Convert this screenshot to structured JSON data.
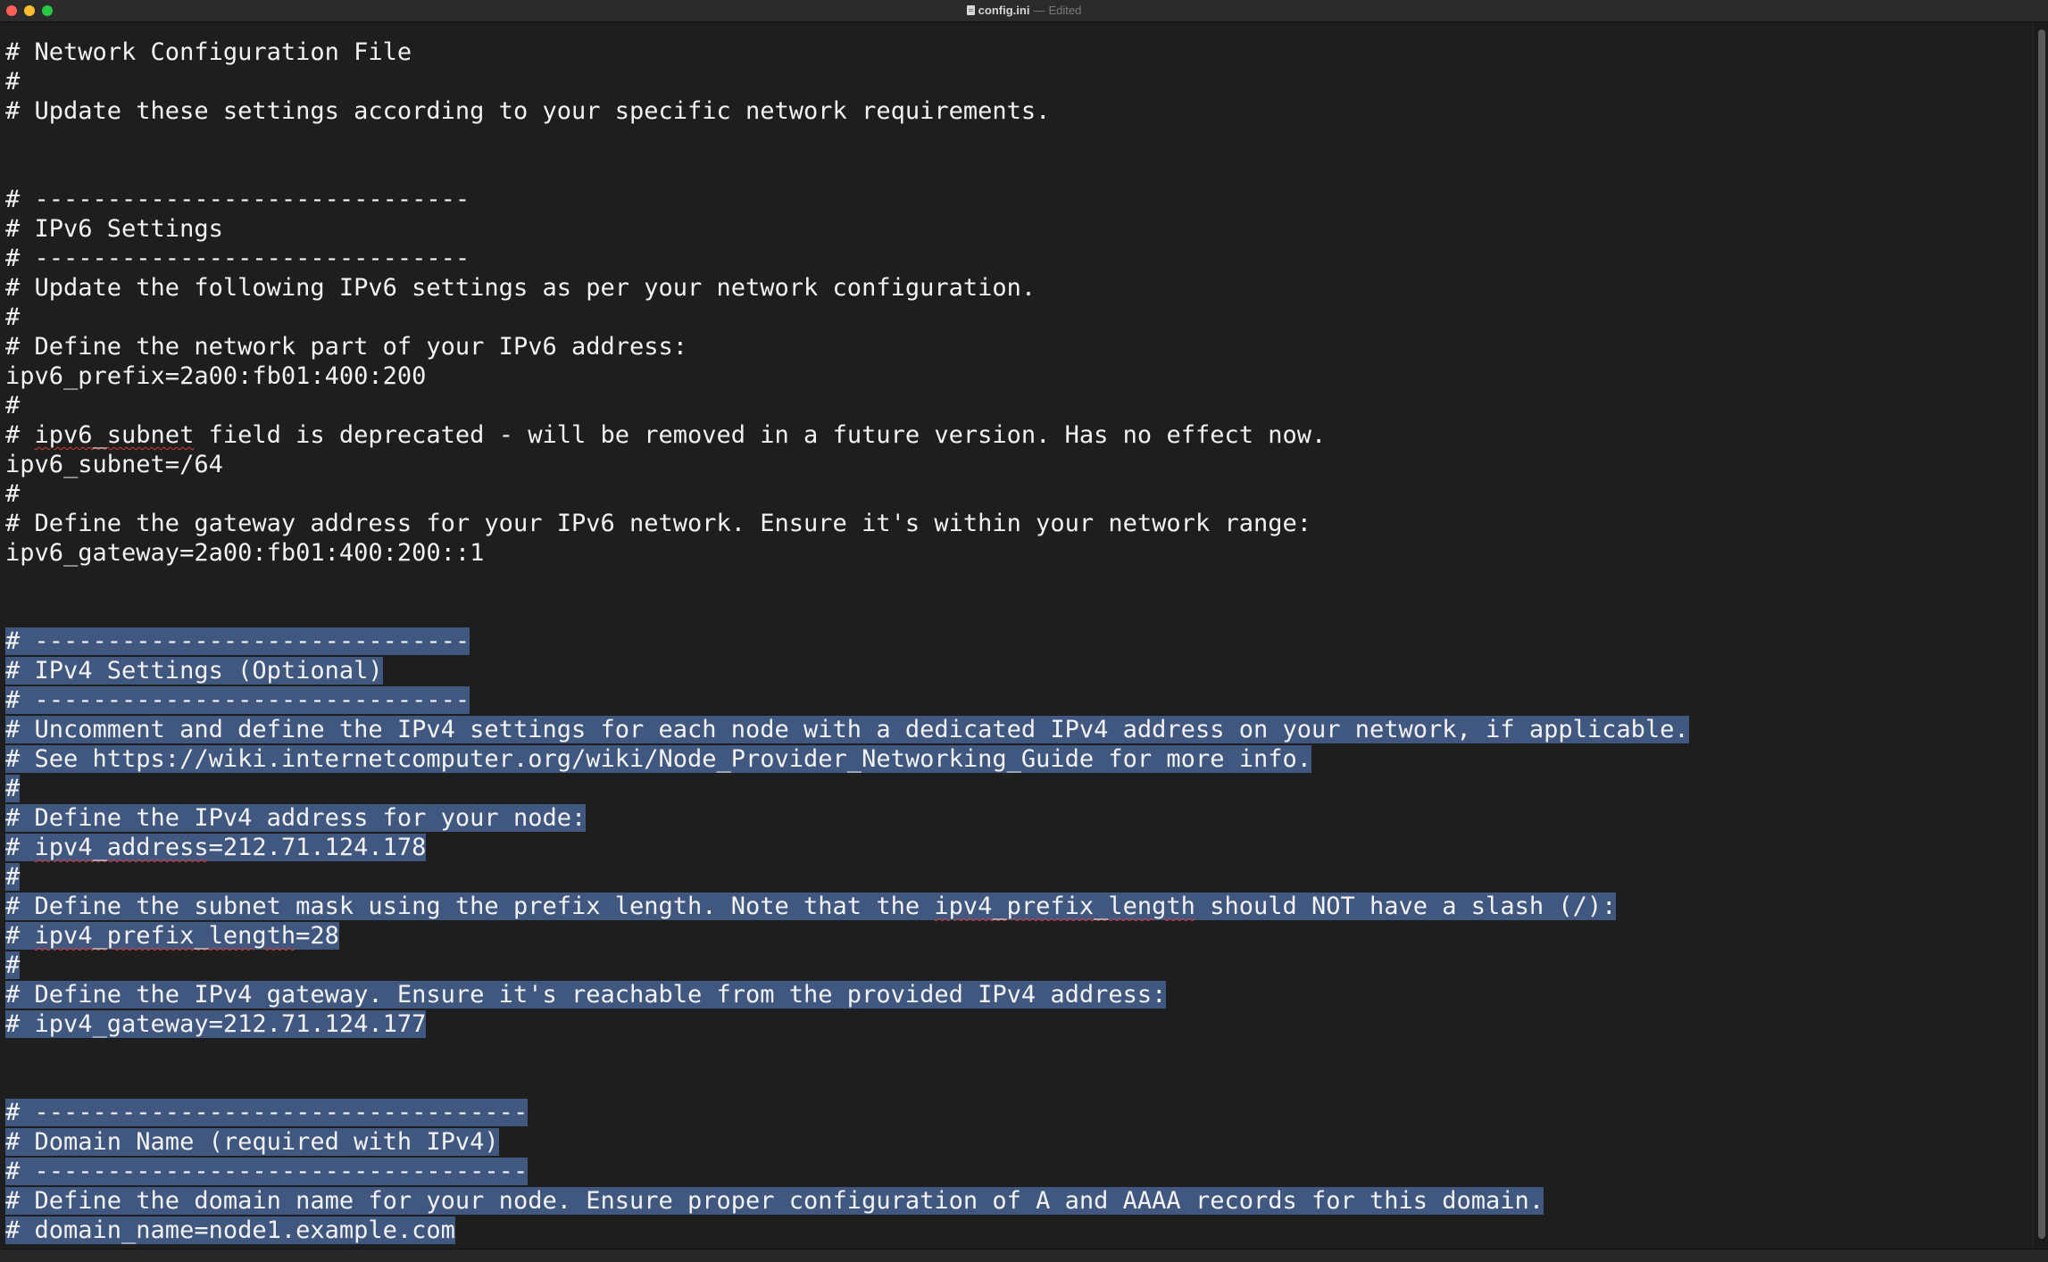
{
  "window": {
    "filename": "config.ini",
    "separator": "—",
    "status": "Edited"
  },
  "document": {
    "lines": [
      {
        "text": "# Network Configuration File",
        "selected": false
      },
      {
        "text": "#",
        "selected": false
      },
      {
        "text": "# Update these settings according to your specific network requirements.",
        "selected": false
      },
      {
        "text": "",
        "selected": false
      },
      {
        "text": "",
        "selected": false
      },
      {
        "text": "# ------------------------------",
        "selected": false
      },
      {
        "text": "# IPv6 Settings",
        "selected": false
      },
      {
        "text": "# ------------------------------",
        "selected": false
      },
      {
        "text": "# Update the following IPv6 settings as per your network configuration.",
        "selected": false
      },
      {
        "text": "#",
        "selected": false
      },
      {
        "text": "# Define the network part of your IPv6 address:",
        "selected": false
      },
      {
        "text": "ipv6_prefix=2a00:fb01:400:200",
        "selected": false
      },
      {
        "text": "#",
        "selected": false
      },
      {
        "text": "# ipv6_subnet field is deprecated - will be removed in a future version. Has no effect now.",
        "selected": false,
        "squiggle": "ipv6_subnet"
      },
      {
        "text": "ipv6_subnet=/64",
        "selected": false
      },
      {
        "text": "#",
        "selected": false
      },
      {
        "text": "# Define the gateway address for your IPv6 network. Ensure it's within your network range:",
        "selected": false
      },
      {
        "text": "ipv6_gateway=2a00:fb01:400:200::1",
        "selected": false
      },
      {
        "text": "",
        "selected": false
      },
      {
        "text": "",
        "selected": false
      },
      {
        "text": "# ------------------------------",
        "selected": true
      },
      {
        "text": "# IPv4 Settings (Optional)",
        "selected": true
      },
      {
        "text": "# ------------------------------",
        "selected": true
      },
      {
        "text": "# Uncomment and define the IPv4 settings for each node with a dedicated IPv4 address on your network, if applicable.",
        "selected": true
      },
      {
        "text": "# See https://wiki.internetcomputer.org/wiki/Node_Provider_Networking_Guide for more info.",
        "selected": true
      },
      {
        "text": "#",
        "selected": true
      },
      {
        "text": "# Define the IPv4 address for your node:",
        "selected": true
      },
      {
        "text": "# ipv4_address=212.71.124.178",
        "selected": true,
        "squiggle": "ipv4_address"
      },
      {
        "text": "#",
        "selected": true
      },
      {
        "text": "# Define the subnet mask using the prefix length. Note that the ipv4_prefix_length should NOT have a slash (/):",
        "selected": true,
        "squiggle": "ipv4_prefix_length"
      },
      {
        "text": "# ipv4_prefix_length=28",
        "selected": true,
        "squiggle": "ipv4_prefix_length"
      },
      {
        "text": "#",
        "selected": true
      },
      {
        "text": "# Define the IPv4 gateway. Ensure it's reachable from the provided IPv4 address:",
        "selected": true
      },
      {
        "text": "# ipv4_gateway=212.71.124.177",
        "selected": true
      },
      {
        "text": "",
        "selected": false
      },
      {
        "text": "",
        "selected": false
      },
      {
        "text": "# ----------------------------------",
        "selected": true
      },
      {
        "text": "# Domain Name (required with IPv4)",
        "selected": true
      },
      {
        "text": "# ----------------------------------",
        "selected": true
      },
      {
        "text": "# Define the domain name for your node. Ensure proper configuration of A and AAAA records for this domain.",
        "selected": true
      },
      {
        "text": "# domain_name=node1.example.com",
        "selected": true
      }
    ]
  },
  "colors": {
    "background": "#1e1e1e",
    "text": "#f2f2f2",
    "selection": "#40577f",
    "spellcheck": "#d23b3b"
  }
}
